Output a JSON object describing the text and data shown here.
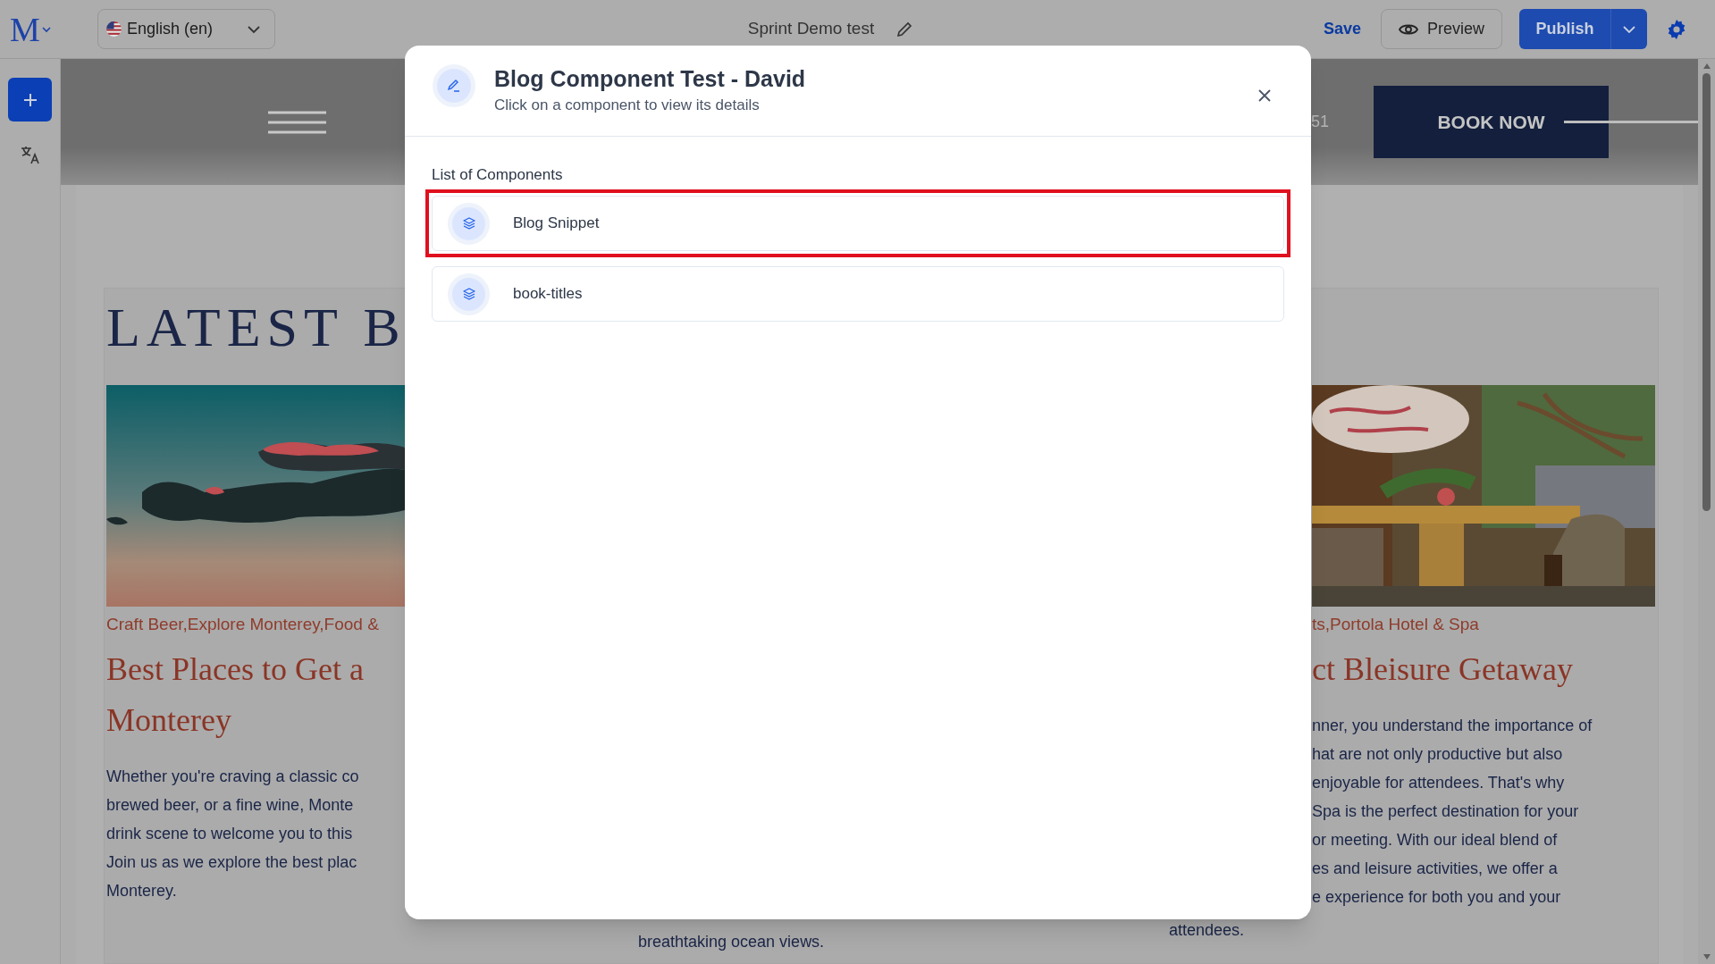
{
  "top_bar": {
    "logo": "M",
    "language": "English (en)",
    "title": "Sprint Demo test",
    "save": "Save",
    "preview": "Preview",
    "publish": "Publish"
  },
  "site_header": {
    "phone_fragment": "51",
    "book_button": "BOOK NOW"
  },
  "section": {
    "heading": "LATEST B",
    "posts": [
      {
        "categories": "Craft Beer,Explore Monterey,Food &",
        "title_lines": [
          "Best Places to Get a",
          "Monterey"
        ],
        "body_lines": [
          "Whether you're craving a classic co",
          "brewed beer, or a fine wine, Monte",
          "drink scene to welcome you to this",
          "Join us as we explore the best plac",
          "Monterey."
        ]
      },
      {
        "categories": "ts,Portola Hotel & Spa",
        "title_lines": [
          "ct Bleisure Getaway"
        ],
        "body_lines": [
          "nner, you understand the importance of",
          "hat are not only productive but also",
          "enjoyable for attendees. That's why",
          "Spa is the perfect destination for your",
          "or meeting. With our ideal blend of",
          "es and leisure activities, we offer a",
          "e experience for both you and your"
        ]
      }
    ],
    "fragments": [
      "breathtaking ocean views.",
      "attendees."
    ]
  },
  "modal": {
    "title": "Blog Component Test - David",
    "subtitle": "Click on a component to view its details",
    "list_label": "List of Components",
    "components": [
      {
        "name": "Blog Snippet",
        "selected": true
      },
      {
        "name": "book-titles",
        "selected": false
      }
    ]
  }
}
